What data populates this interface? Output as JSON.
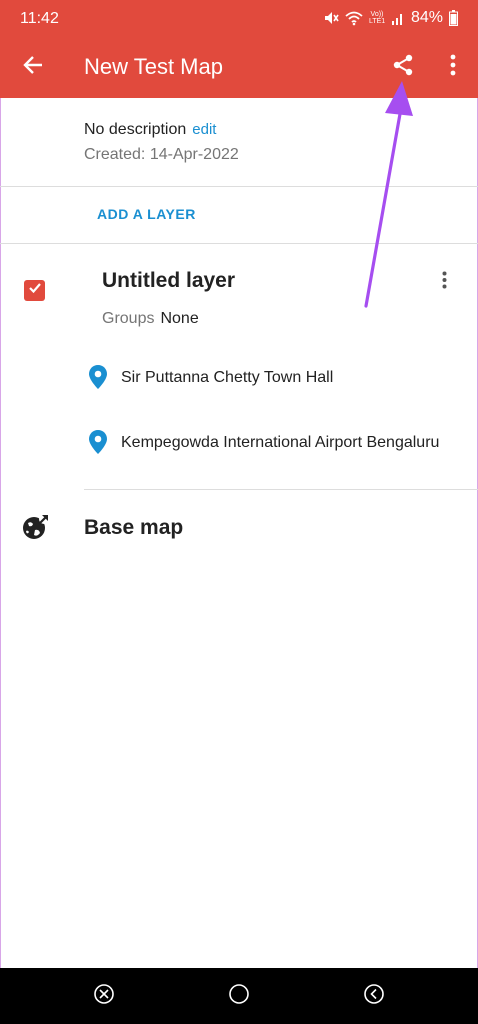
{
  "status_bar": {
    "time": "11:42",
    "network_label": "Vo)) LTE1",
    "battery": "84%"
  },
  "app_bar": {
    "title": "New Test Map",
    "icons": [
      "back-arrow-icon",
      "share-icon",
      "more-vert-icon"
    ]
  },
  "map_info": {
    "description": "No description",
    "edit_label": "edit",
    "created": "Created: 14-Apr-2022"
  },
  "add_layer_label": "ADD A LAYER",
  "layer": {
    "title": "Untitled layer",
    "checked": true,
    "groups_label": "Groups",
    "groups_value": "None",
    "places": [
      {
        "label": "Sir Puttanna Chetty Town Hall",
        "icon": "location-pin-icon"
      },
      {
        "label": "Kempegowda International Airport Bengaluru",
        "icon": "location-pin-icon"
      }
    ]
  },
  "base_map": {
    "label": "Base map",
    "icon": "globe-icon"
  },
  "nav_bar": {
    "icons": [
      "recents-icon",
      "home-icon",
      "back-icon"
    ]
  },
  "colors": {
    "accent": "#e14a3d",
    "link": "#1a8fd1",
    "pin": "#1a8fd1",
    "annotation_arrow": "#a64ef0"
  }
}
